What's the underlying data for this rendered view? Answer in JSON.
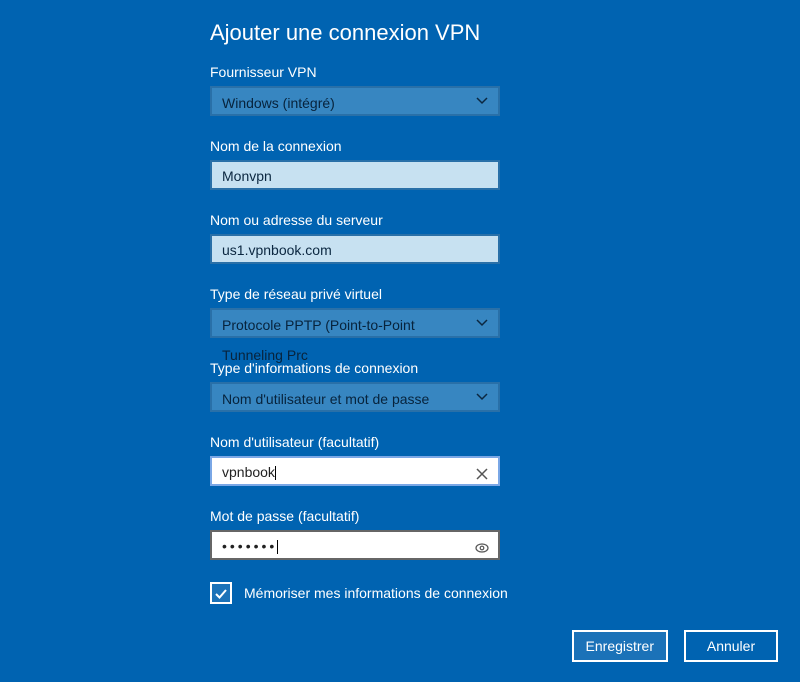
{
  "heading": "Ajouter une connexion VPN",
  "fields": {
    "provider": {
      "label": "Fournisseur VPN",
      "value": "Windows (intégré)"
    },
    "connName": {
      "label": "Nom de la connexion",
      "value": "Monvpn"
    },
    "server": {
      "label": "Nom ou adresse du serveur",
      "value": "us1.vpnbook.com"
    },
    "vpnType": {
      "label": "Type de réseau privé virtuel",
      "value": "Protocole PPTP (Point-to-Point Tunneling Prc"
    },
    "signinType": {
      "label": "Type d'informations de connexion",
      "value": "Nom d'utilisateur et mot de passe"
    },
    "username": {
      "label": "Nom d'utilisateur (facultatif)",
      "value": "vpnbook"
    },
    "password": {
      "label": "Mot de passe (facultatif)",
      "masked": "•••••••"
    }
  },
  "remember": {
    "label": "Mémoriser mes informations de connexion",
    "checked": true
  },
  "buttons": {
    "save": "Enregistrer",
    "cancel": "Annuler"
  }
}
